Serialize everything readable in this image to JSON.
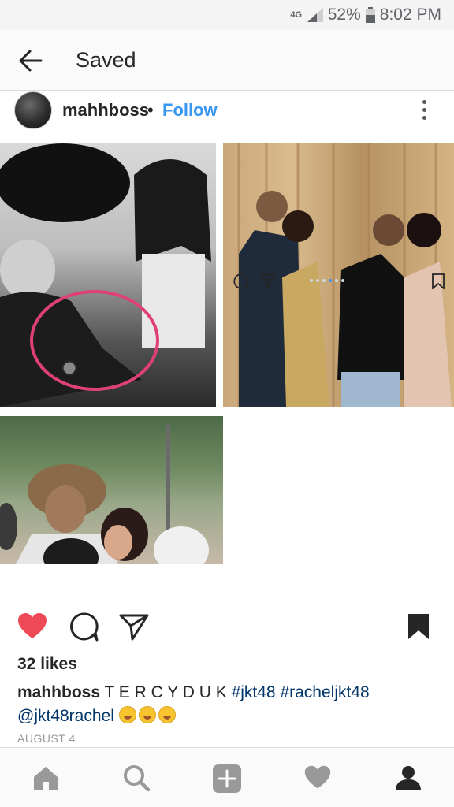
{
  "status_bar": {
    "network": "4G",
    "battery": "52%",
    "time": "8:02 PM"
  },
  "header": {
    "title": "Saved",
    "back_icon": "arrow-left-icon"
  },
  "post": {
    "username": "mahhboss",
    "separator": "•",
    "follow_label": "Follow",
    "likes": "32 likes",
    "caption": {
      "username": "mahhboss",
      "text": "T E R C Y D U K",
      "hashtags": [
        "#jkt48",
        "#racheljkt48"
      ],
      "mention": "@jkt48rachel"
    },
    "date": "AUGUST 4"
  },
  "colors": {
    "like_red": "#ed4956",
    "follow_blue": "#3897f0",
    "hashtag": "#003569",
    "nav_grey": "#999999",
    "text": "#262626"
  },
  "icons": {
    "action_bar": [
      "heart-filled-icon",
      "comment-icon",
      "send-icon",
      "bookmark-filled-icon"
    ],
    "bottom_nav": [
      "home-icon",
      "search-icon",
      "add-icon",
      "heart-icon",
      "profile-icon"
    ]
  }
}
